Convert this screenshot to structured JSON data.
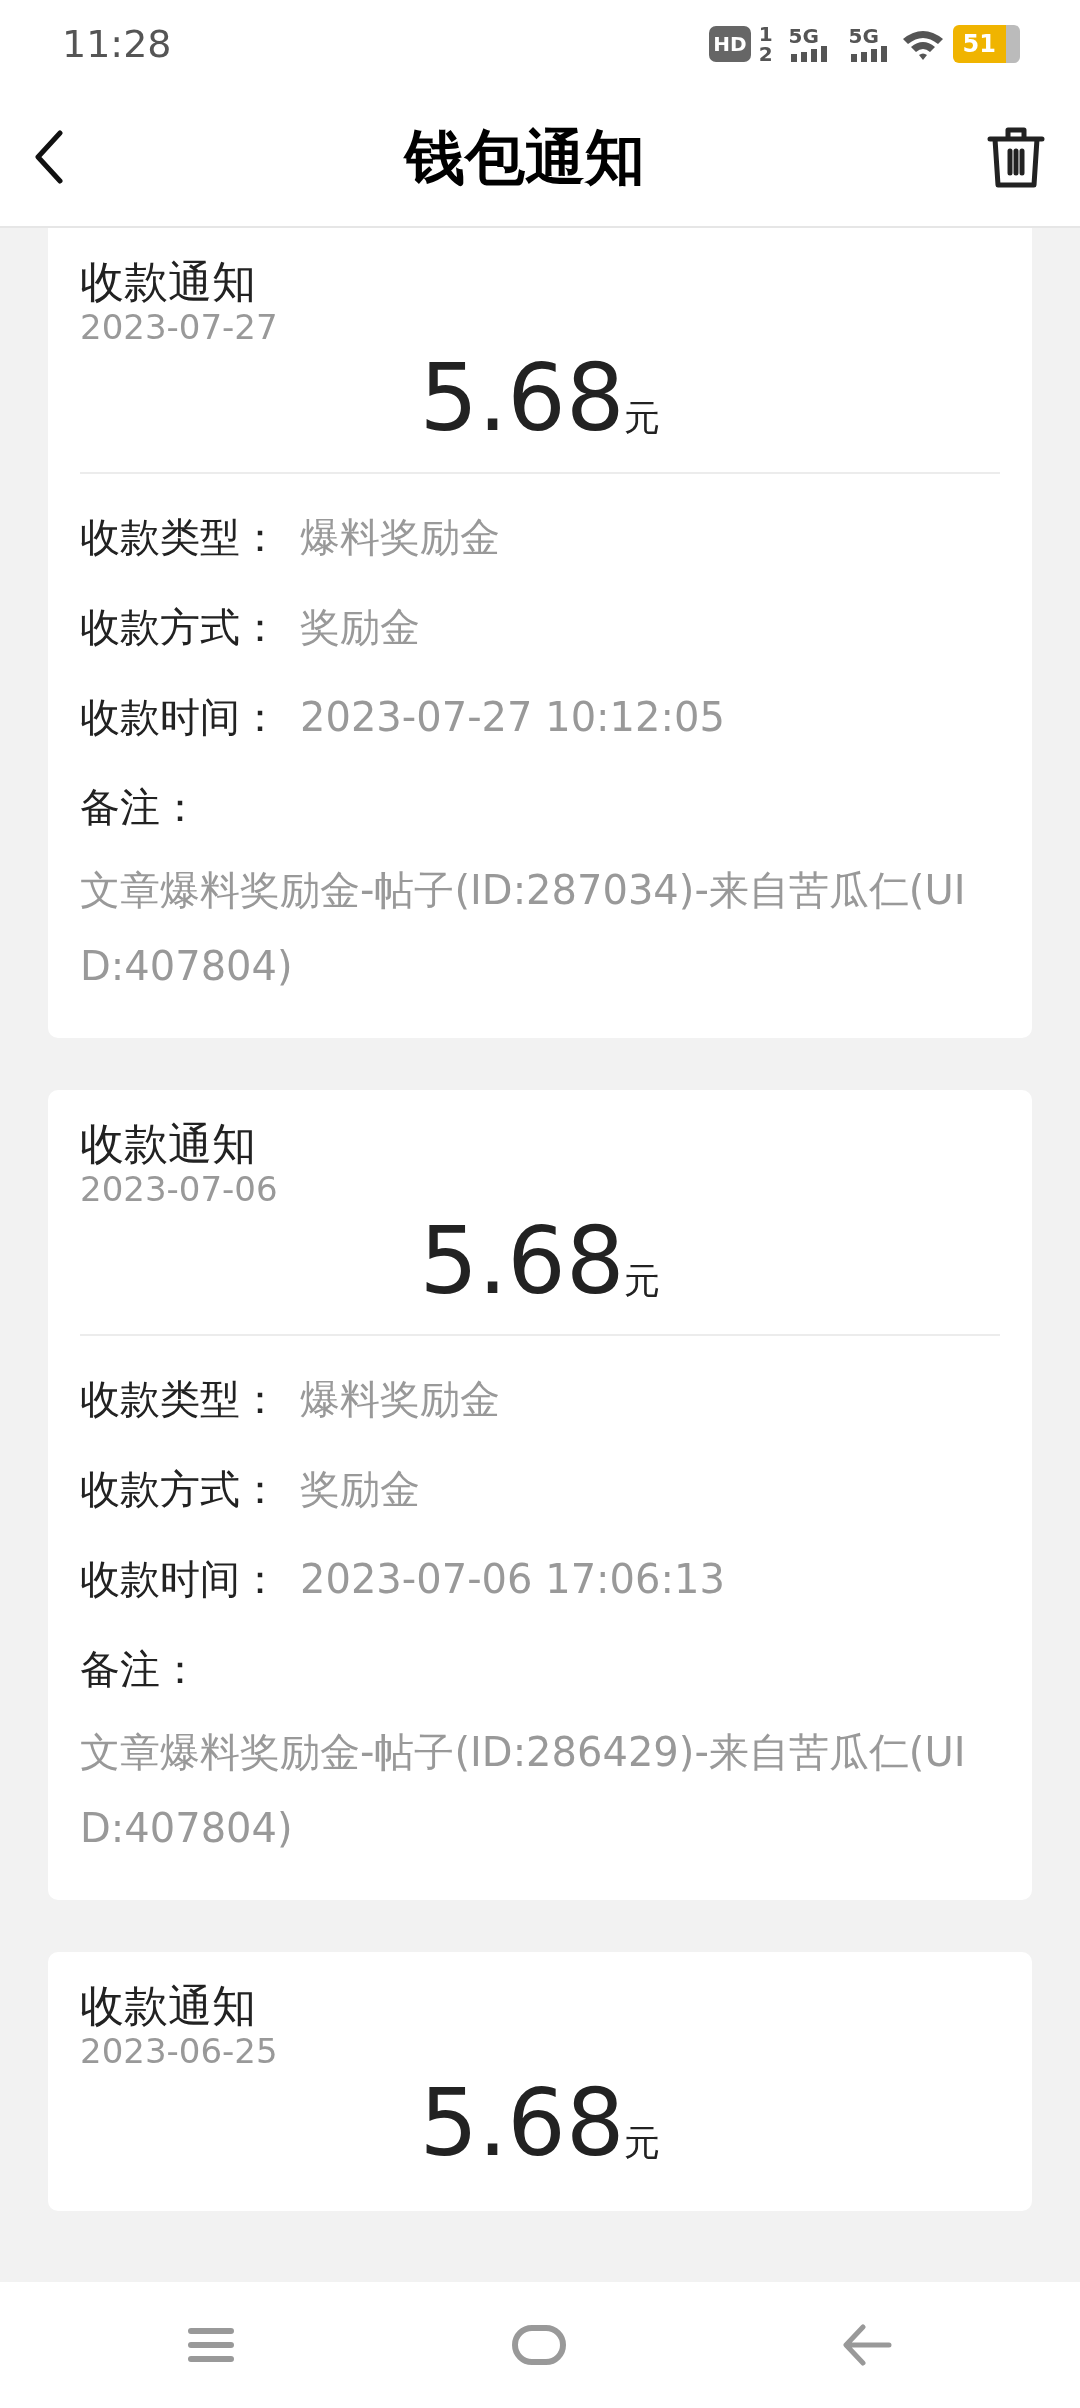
{
  "status_bar": {
    "time": "11:28",
    "hd": "HD",
    "sims": [
      "1",
      "2"
    ],
    "networks": [
      "5G",
      "5G"
    ],
    "battery": "51"
  },
  "header": {
    "title": "钱包通知"
  },
  "notifications": [
    {
      "title": "收款通知",
      "date": "2023-07-27",
      "amount": "5.68",
      "unit": "元",
      "fields": [
        {
          "label": "收款类型：",
          "value": "爆料奖励金"
        },
        {
          "label": "收款方式：",
          "value": "奖励金"
        },
        {
          "label": "收款时间：",
          "value": "2023-07-27 10:12:05"
        }
      ],
      "remark_label": "备注：",
      "remark": "文章爆料奖励金-帖子(ID:287034)-来自苦瓜仁(UID:407804)"
    },
    {
      "title": "收款通知",
      "date": "2023-07-06",
      "amount": "5.68",
      "unit": "元",
      "fields": [
        {
          "label": "收款类型：",
          "value": "爆料奖励金"
        },
        {
          "label": "收款方式：",
          "value": "奖励金"
        },
        {
          "label": "收款时间：",
          "value": "2023-07-06 17:06:13"
        }
      ],
      "remark_label": "备注：",
      "remark": "文章爆料奖励金-帖子(ID:286429)-来自苦瓜仁(UID:407804)"
    },
    {
      "title": "收款通知",
      "date": "2023-06-25",
      "amount": "5.68",
      "unit": "元"
    }
  ]
}
